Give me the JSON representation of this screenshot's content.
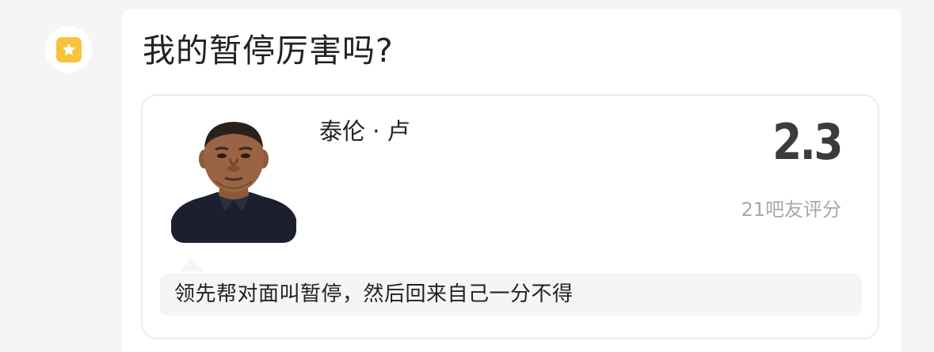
{
  "icons": {
    "badge": "star-icon"
  },
  "colors": {
    "badge_yellow": "#f9c23c",
    "score_text": "#3b3b3b",
    "muted_text": "#a8a8ad",
    "bubble_bg": "#f5f5f7"
  },
  "question": {
    "title": "我的暂停厉害吗?"
  },
  "player": {
    "name": "泰伦 · 卢",
    "score": "2.3",
    "rating_count": "21吧友评分",
    "comment": "领先帮对面叫暂停，然后回来自己一分不得"
  }
}
